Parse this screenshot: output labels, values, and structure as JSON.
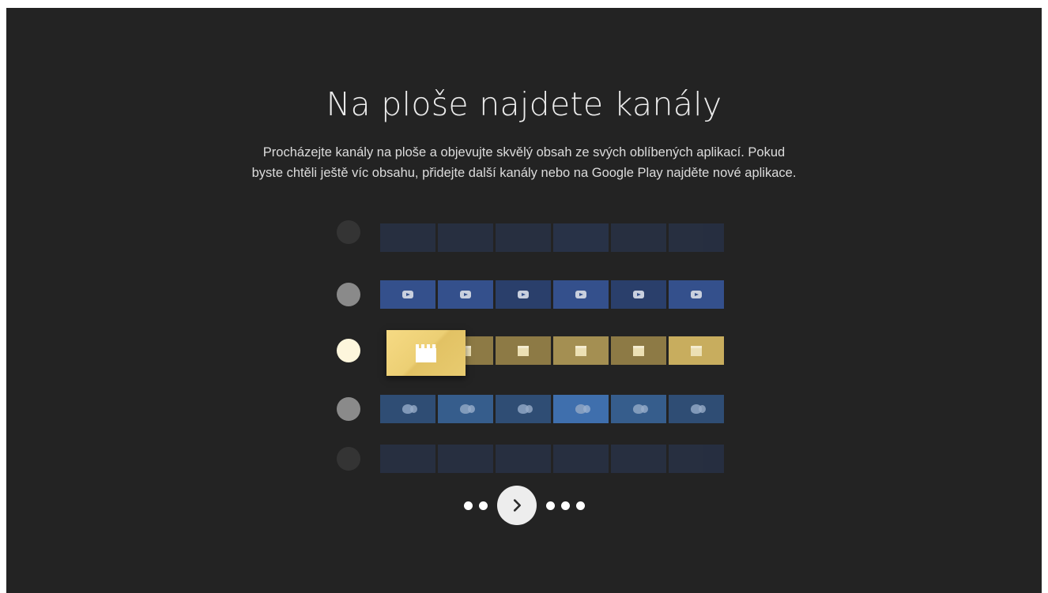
{
  "onboarding": {
    "title": "Na ploše najdete kanály",
    "description": "Procházejte kanály na ploše a objevujte skvělý obsah ze svých oblíbených aplikací. Pokud byste chtěli ještě víc obsahu, přidejte další kanály nebo na Google Play najděte nové aplikace."
  },
  "illustration": {
    "rows": [
      {
        "kind": "faded",
        "icon": "youtube-icon"
      },
      {
        "kind": "youtube",
        "icon": "youtube-icon"
      },
      {
        "kind": "movies",
        "icon": "clapperboard-icon",
        "focused": true
      },
      {
        "kind": "theater",
        "icon": "theater-masks-icon"
      },
      {
        "kind": "faded",
        "icon": "generic-icon"
      }
    ],
    "colors": {
      "background": "#232323",
      "youtube_tile": "#34508c",
      "movies_tile": "#a48f52",
      "focused_tile": "#f0d47a",
      "theater_tile": "#365d8c"
    }
  },
  "pager": {
    "dots_before": 2,
    "dots_after": 3,
    "next_icon": "chevron-right-icon"
  }
}
